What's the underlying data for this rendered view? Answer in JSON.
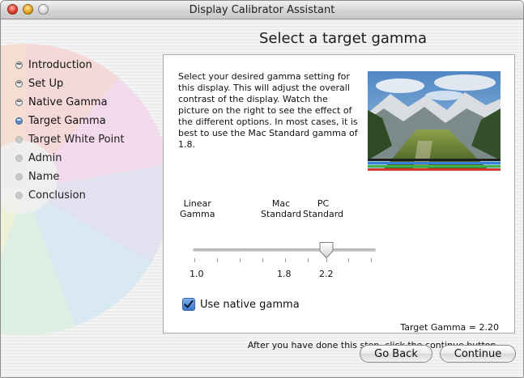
{
  "window": {
    "title": "Display Calibrator Assistant"
  },
  "page": {
    "heading": "Select a target gamma"
  },
  "steps": [
    {
      "label": "Introduction",
      "state": "done"
    },
    {
      "label": "Set Up",
      "state": "done"
    },
    {
      "label": "Native Gamma",
      "state": "done"
    },
    {
      "label": "Target Gamma",
      "state": "current"
    },
    {
      "label": "Target White Point",
      "state": "future"
    },
    {
      "label": "Admin",
      "state": "future"
    },
    {
      "label": "Name",
      "state": "future"
    },
    {
      "label": "Conclusion",
      "state": "future"
    }
  ],
  "content": {
    "description": "Select your desired gamma setting for this display. This will adjust the overall contrast of the display.  Watch the picture on the right to see the effect of the different options.  In most cases, it is best to use the Mac Standard gamma of 1.8.",
    "preview_image": "mountain-valley-landscape",
    "color_bars": [
      "#1e1e1e",
      "#3a7fd8",
      "#3fb34a",
      "#d83a2e"
    ]
  },
  "slider": {
    "label_linear_1": "Linear",
    "label_linear_2": "Gamma",
    "label_mac_1": "Mac",
    "label_mac_2": "Standard",
    "label_pc_1": "PC",
    "label_pc_2": "Standard",
    "value_1": "1.0",
    "value_2": "1.8",
    "value_3": "2.2",
    "current": 2.2,
    "min": 1.0,
    "max": 2.6
  },
  "checkbox": {
    "label": "Use native gamma",
    "checked": true
  },
  "readout": "Target Gamma = 2.20",
  "instructions": "After you have done this step, click the continue button.",
  "buttons": {
    "back": "Go Back",
    "continue": "Continue"
  },
  "colors": {
    "accent": "#3d78cc",
    "current_step": "#5b89c9"
  }
}
